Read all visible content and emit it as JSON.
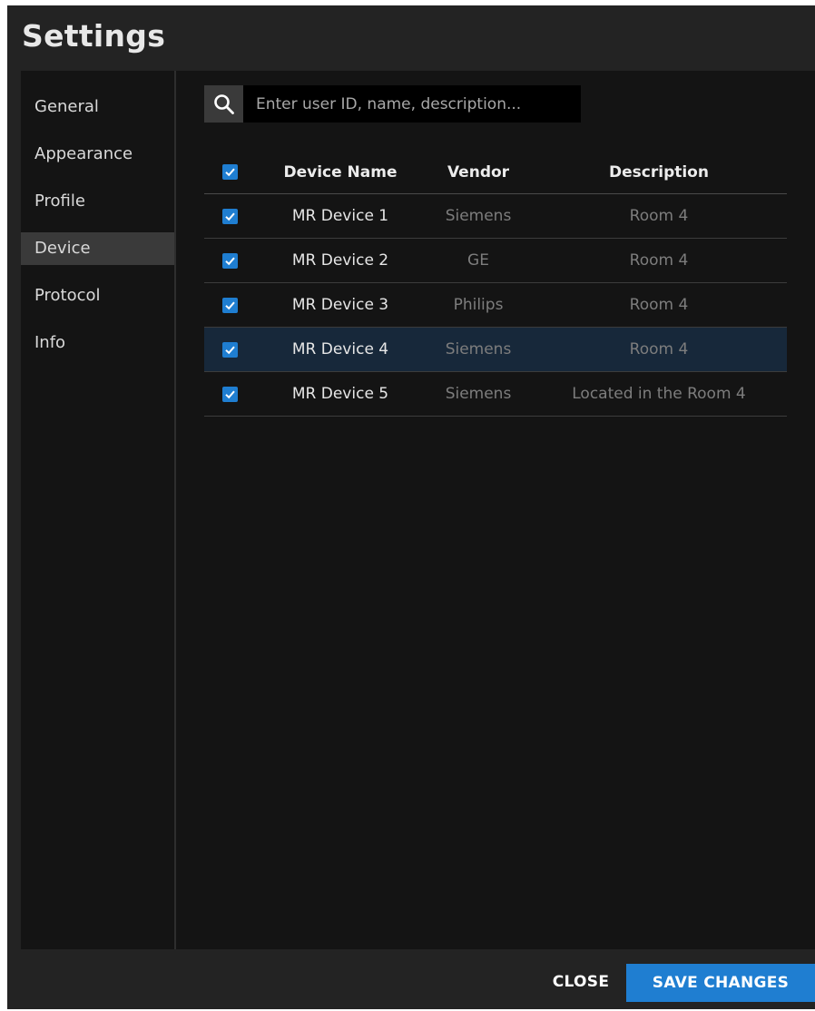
{
  "window": {
    "title": "Settings"
  },
  "sidebar": {
    "items": [
      {
        "label": "General"
      },
      {
        "label": "Appearance"
      },
      {
        "label": "Profile"
      },
      {
        "label": "Device"
      },
      {
        "label": "Protocol"
      },
      {
        "label": "Info"
      }
    ],
    "active_index": 3
  },
  "search": {
    "placeholder": "Enter user ID, name, description...",
    "value": ""
  },
  "table": {
    "columns": [
      "Device Name",
      "Vendor",
      "Description"
    ],
    "select_all_checked": true,
    "rows": [
      {
        "name": "MR Device 1",
        "vendor": "Siemens",
        "description": "Room 4",
        "checked": true,
        "selected": false
      },
      {
        "name": "MR Device 2",
        "vendor": "GE",
        "description": "Room 4",
        "checked": true,
        "selected": false
      },
      {
        "name": "MR Device 3",
        "vendor": "Philips",
        "description": "Room 4",
        "checked": true,
        "selected": false
      },
      {
        "name": "MR Device 4",
        "vendor": "Siemens",
        "description": "Room 4",
        "checked": true,
        "selected": true
      },
      {
        "name": "MR Device 5",
        "vendor": "Siemens",
        "description": "Located in the Room 4",
        "checked": true,
        "selected": false
      }
    ]
  },
  "footer": {
    "close_label": "CLOSE",
    "save_label": "SAVE CHANGES"
  },
  "colors": {
    "accent": "#1f7ed1",
    "selected_row": "#17283a",
    "panel_bg": "#141414",
    "chrome_bg": "#232323"
  },
  "icons": {
    "search": "search-icon",
    "check": "checkmark-icon"
  }
}
